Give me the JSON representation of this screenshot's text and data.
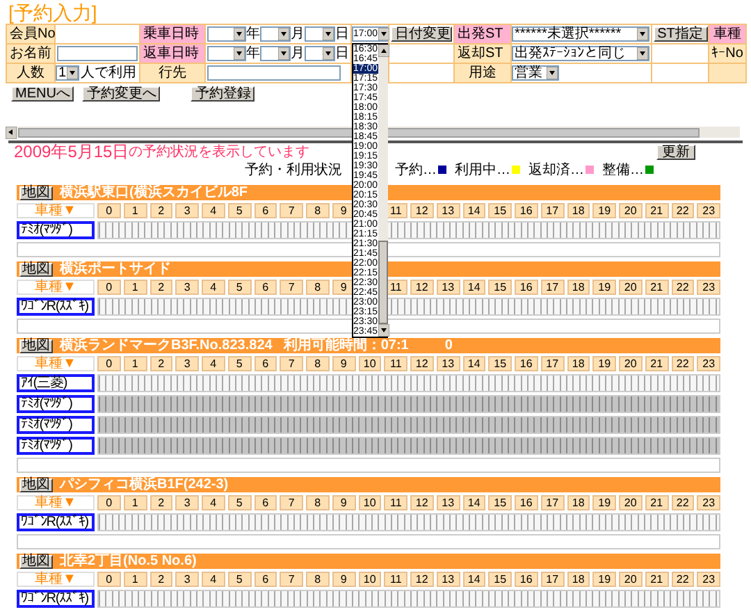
{
  "title": "[予約入力]",
  "form": {
    "member_label": {
      "text": "会員No",
      "required": false
    },
    "name_label": {
      "text": "お名前",
      "required": false
    },
    "people_label": {
      "text": "人数",
      "required": false
    },
    "people_select": {
      "value": "1"
    },
    "people_suffix": "人で利用",
    "pickup_label": {
      "text": "乗車日時",
      "required": true
    },
    "pickup_units": [
      "年",
      "月",
      "日"
    ],
    "pickup_time": {
      "value": "17:00",
      "expanded": true,
      "options": [
        {
          "text": "16:30",
          "selected": false
        },
        {
          "text": "16:45",
          "selected": false
        },
        {
          "text": "17:00",
          "selected": true
        },
        {
          "text": "17:15",
          "selected": false
        },
        {
          "text": "17:30",
          "selected": false
        },
        {
          "text": "17:45",
          "selected": false
        },
        {
          "text": "18:00",
          "selected": false
        },
        {
          "text": "18:15",
          "selected": false
        },
        {
          "text": "18:30",
          "selected": false
        },
        {
          "text": "18:45",
          "selected": false
        },
        {
          "text": "19:00",
          "selected": false
        },
        {
          "text": "19:15",
          "selected": false
        },
        {
          "text": "19:30",
          "selected": false
        },
        {
          "text": "19:45",
          "selected": false
        },
        {
          "text": "20:00",
          "selected": false
        },
        {
          "text": "20:15",
          "selected": false
        },
        {
          "text": "20:30",
          "selected": false
        },
        {
          "text": "20:45",
          "selected": false
        },
        {
          "text": "21:00",
          "selected": false
        },
        {
          "text": "21:15",
          "selected": false
        },
        {
          "text": "21:30",
          "selected": false
        },
        {
          "text": "21:45",
          "selected": false
        },
        {
          "text": "22:00",
          "selected": false
        },
        {
          "text": "22:15",
          "selected": false
        },
        {
          "text": "22:30",
          "selected": false
        },
        {
          "text": "22:45",
          "selected": false
        },
        {
          "text": "23:00",
          "selected": false
        },
        {
          "text": "23:15",
          "selected": false
        },
        {
          "text": "23:30",
          "selected": false
        },
        {
          "text": "23:45",
          "selected": false
        }
      ]
    },
    "date_change_button": "日付変更",
    "return_label": {
      "text": "返車日時",
      "required": true
    },
    "return_units": [
      "年",
      "月",
      "日"
    ],
    "destination_label": {
      "text": "行先",
      "required": false
    },
    "depart_label": {
      "text": "出発ST",
      "required": true
    },
    "depart_select": {
      "value": "******未選択******"
    },
    "st_button": "ST指定",
    "return_st_label": {
      "text": "返却ST",
      "required": false
    },
    "return_st_select": {
      "value": "出発ｽﾃｰｼｮﾝと同じ"
    },
    "purpose_label": {
      "text": "用途",
      "required": false
    },
    "purpose_select": {
      "value": "営業"
    },
    "car_type_label": {
      "text": "車種",
      "required": true
    },
    "key_no_label": {
      "text": "ｷｰNo",
      "required": false
    }
  },
  "buttons": [
    "MENUへ",
    "予約変更へ",
    "予約登録"
  ],
  "heading": {
    "date": "2009年5月15日",
    "text": "の予約状況を表示しています"
  },
  "refresh_button": "更新",
  "legend": {
    "label": "予約・利用状況",
    "items": [
      {
        "text": "予約…",
        "color": "#000099"
      },
      {
        "text": "利用中…",
        "color": "#ffff00"
      },
      {
        "text": "返却済…",
        "color": "#ff99cc"
      },
      {
        "text": "整備…",
        "color": "#009900"
      }
    ]
  },
  "sections": [
    {
      "map_button": "地図",
      "name": "横浜駅東口(横浜スカイビル8F",
      "car_header": "車種▼",
      "hours_before_list": [
        "0",
        "1",
        "2",
        "3",
        "4",
        "5",
        "6",
        "7",
        "8",
        "9"
      ],
      "hours_after_list": [
        "11",
        "12",
        "13",
        "14",
        "15",
        "16",
        "17",
        "18",
        "19",
        "20",
        "21",
        "22",
        "23"
      ],
      "vehicles": [
        {
          "name": "ﾃﾐｵ(ﾏﾂﾀﾞ)",
          "disabled": false
        }
      ]
    },
    {
      "map_button": "地図",
      "name": "横浜ポートサイド",
      "car_header": "車種▼",
      "hours_before_list": [
        "0",
        "1",
        "2",
        "3",
        "4",
        "5",
        "6",
        "7",
        "8",
        "9"
      ],
      "hours_after_list": [
        "11",
        "12",
        "13",
        "14",
        "15",
        "16",
        "17",
        "18",
        "19",
        "20",
        "21",
        "22",
        "23"
      ],
      "vehicles": [
        {
          "name": "ﾜｺﾞﾝR(ｽｽﾞｷ)",
          "disabled": false
        }
      ]
    },
    {
      "map_button": "地図",
      "name": "横浜ランドマークB3F.No.823.824",
      "availability": {
        "start": "利用可能時間：07:1",
        "end": "0"
      },
      "car_header": "車種▼",
      "hours": [
        "0",
        "1",
        "2",
        "3",
        "4",
        "5",
        "6",
        "7",
        "8",
        "9",
        "10",
        "11",
        "12",
        "13",
        "14",
        "15",
        "16",
        "17",
        "18",
        "19",
        "20",
        "21",
        "22",
        "23"
      ],
      "vehicles": [
        {
          "name": "ｱｲ(三菱)",
          "disabled": false
        },
        {
          "name": "ﾃﾐｵ(ﾏﾂﾀﾞ)",
          "disabled": true
        },
        {
          "name": "ﾃﾐｵ(ﾏﾂﾀﾞ)",
          "disabled": true
        },
        {
          "name": "ﾃﾐｵ(ﾏﾂﾀﾞ)",
          "disabled": true
        }
      ]
    },
    {
      "map_button": "地図",
      "name": "パシフィコ横浜B1F(242-3)",
      "car_header": "車種▼",
      "hours": [
        "0",
        "1",
        "2",
        "3",
        "4",
        "5",
        "6",
        "7",
        "8",
        "9",
        "10",
        "11",
        "12",
        "13",
        "14",
        "15",
        "16",
        "17",
        "18",
        "19",
        "20",
        "21",
        "22",
        "23"
      ],
      "vehicles": [
        {
          "name": "ﾜｺﾞﾝR(ｽｽﾞｷ)",
          "disabled": false
        }
      ]
    },
    {
      "map_button": "地図",
      "name": "北幸2丁目(No.5 No.6)",
      "car_header": "車種▼",
      "hours": [
        "0",
        "1",
        "2",
        "3",
        "4",
        "5",
        "6",
        "7",
        "8",
        "9",
        "10",
        "11",
        "12",
        "13",
        "14",
        "15",
        "16",
        "17",
        "18",
        "19",
        "20",
        "21",
        "22",
        "23"
      ],
      "vehicles": [
        {
          "name": "ﾜｺﾞﾝR(ｽｽﾞｷ)",
          "disabled": false
        }
      ]
    }
  ]
}
